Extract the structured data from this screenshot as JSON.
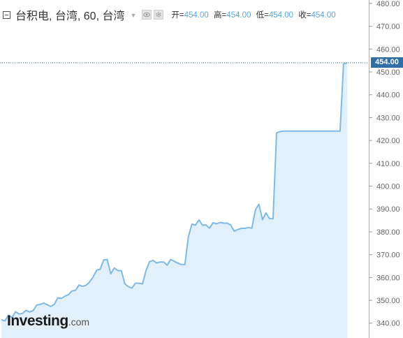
{
  "legend": {
    "symbol_title": "台积电, 台湾, 60, 台湾",
    "open_label": "开=",
    "open_value": "454.00",
    "high_label": "高=",
    "high_value": "454.00",
    "low_label": "低=",
    "low_value": "454.00",
    "close_label": "收=",
    "close_value": "454.00"
  },
  "last_price_label": "454.00",
  "logo": {
    "main": "Investing",
    "suffix": ".com"
  },
  "colors": {
    "line": "#7fb9e6",
    "area": "#e1f0fa",
    "price_tag": "#2f6fa6",
    "value_text": "#5ba6dd"
  },
  "icons": {
    "eye": "eye-icon",
    "settings": "gear-icon",
    "collapse": "collapse-icon",
    "dropdown": "chevron-down-icon"
  },
  "chart_data": {
    "type": "area",
    "ylim": [
      333.5,
      481.5
    ],
    "yticks": [
      340,
      350,
      360,
      370,
      380,
      390,
      400,
      410,
      420,
      430,
      440,
      450,
      460,
      470,
      480
    ],
    "ytick_labels": [
      "340.00",
      "350.00",
      "360.00",
      "370.00",
      "380.00",
      "390.00",
      "400.00",
      "410.00",
      "420.00",
      "430.00",
      "440.00",
      "450.00",
      "460.00",
      "470.00",
      "480.00"
    ],
    "last_value": 454.0,
    "x": [
      0,
      1,
      2,
      3,
      4,
      5,
      6,
      7,
      8,
      9,
      10,
      11,
      12,
      13,
      14,
      15,
      16,
      17,
      18,
      19,
      20,
      21,
      22,
      23,
      24,
      25,
      26,
      27,
      28,
      29,
      30,
      31,
      32,
      33,
      34,
      35,
      36,
      37,
      38,
      39,
      40,
      41,
      42,
      43,
      44,
      45,
      46,
      47,
      48,
      49,
      50,
      51,
      52,
      53,
      54,
      55,
      56,
      57,
      58,
      59,
      60,
      61,
      62,
      63,
      64,
      65,
      66,
      67,
      68,
      69,
      70,
      71,
      72,
      73,
      74,
      75,
      76,
      77,
      78,
      79,
      80,
      81,
      82,
      83,
      84,
      85,
      86,
      87,
      88,
      89,
      90,
      91,
      92,
      93,
      94,
      95,
      96,
      97,
      98
    ],
    "values": [
      341.5,
      341.0,
      343.5,
      342.5,
      345.0,
      344.0,
      344.3,
      345.6,
      344.9,
      345.5,
      347.9,
      348.2,
      348.8,
      348.1,
      347.3,
      348.3,
      351.1,
      350.8,
      351.8,
      352.5,
      354.1,
      354.4,
      356.7,
      356.1,
      356.6,
      358.0,
      360.2,
      363.2,
      363.6,
      367.7,
      367.9,
      361.6,
      364.2,
      363.0,
      363.0,
      357.2,
      356.0,
      355.4,
      357.5,
      357.5,
      357.2,
      363.1,
      366.9,
      367.5,
      366.3,
      366.8,
      366.8,
      365.4,
      367.9,
      367.1,
      366.3,
      365.7,
      365.7,
      377.8,
      383.4,
      382.9,
      385.2,
      382.9,
      383.0,
      381.6,
      384.0,
      383.5,
      384.1,
      383.8,
      383.8,
      383.0,
      380.3,
      381.0,
      381.5,
      381.5,
      381.9,
      381.6,
      389.6,
      392.1,
      385.3,
      388.3,
      385.8,
      385.7,
      423.3,
      423.9,
      424.1,
      424.1,
      424.1,
      424.1,
      424.1,
      424.1,
      424.1,
      424.1,
      424.1,
      424.1,
      424.1,
      424.1,
      424.1,
      424.1,
      424.1,
      424.1,
      424.1,
      453.5,
      454.0
    ]
  }
}
